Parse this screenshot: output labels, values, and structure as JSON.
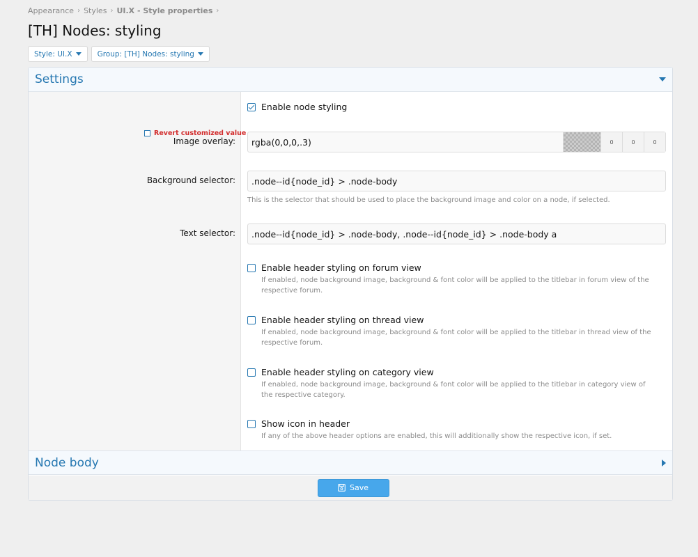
{
  "breadcrumb": [
    {
      "label": "Appearance"
    },
    {
      "label": "Styles"
    },
    {
      "label": "UI.X - Style properties"
    }
  ],
  "page_title": "[TH] Nodes: styling",
  "filters": {
    "style": "Style: UI.X",
    "group": "Group: [TH] Nodes: styling"
  },
  "settings": {
    "title": "Settings",
    "revert_label": "Revert customized value",
    "enable_node_styling": "Enable node styling",
    "image_overlay": {
      "label": "Image overlay:",
      "value": "rgba(0,0,0,.3)",
      "r": "0",
      "g": "0",
      "b": "0"
    },
    "background_selector": {
      "label": "Background selector:",
      "value": ".node--id{node_id} > .node-body",
      "hint": "This is the selector that should be used to place the background image and color on a node, if selected."
    },
    "text_selector": {
      "label": "Text selector:",
      "value": ".node--id{node_id} > .node-body, .node--id{node_id} > .node-body a"
    },
    "options": [
      {
        "label": "Enable header styling on forum view",
        "desc": "If enabled, node background image, background & font color will be applied to the titlebar in forum view of the respective forum."
      },
      {
        "label": "Enable header styling on thread view",
        "desc": "If enabled, node background image, background & font color will be applied to the titlebar in thread view of the respective forum."
      },
      {
        "label": "Enable header styling on category view",
        "desc": "If enabled, node background image, background & font color will be applied to the titlebar in category view of the respective category."
      },
      {
        "label": "Show icon in header",
        "desc": "If any of the above header options are enabled, this will additionally show the respective icon, if set."
      }
    ]
  },
  "node_body": {
    "title": "Node body"
  },
  "save_label": "Save",
  "colors": {
    "accent": "#2577b1",
    "button": "#47a7eb",
    "revert": "#d22d2d"
  }
}
